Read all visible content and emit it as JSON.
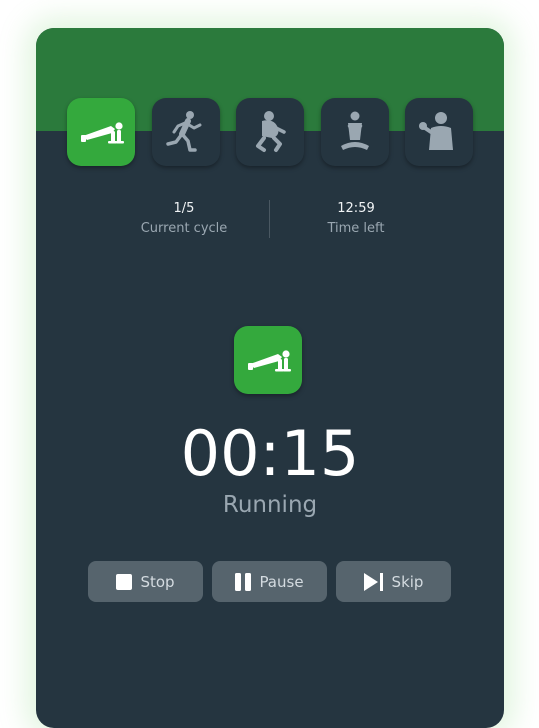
{
  "exercises": [
    {
      "name": "push-up",
      "active": true
    },
    {
      "name": "running",
      "active": false
    },
    {
      "name": "squat",
      "active": false
    },
    {
      "name": "meditation",
      "active": false
    },
    {
      "name": "dumbbell",
      "active": false
    }
  ],
  "stats": {
    "cycle_value": "1/5",
    "cycle_label": "Current cycle",
    "time_value": "12:59",
    "time_label": "Time left"
  },
  "current": {
    "icon": "push-up-icon",
    "timer": "00:15",
    "status": "Running"
  },
  "controls": {
    "stop_label": "Stop",
    "pause_label": "Pause",
    "skip_label": "Skip"
  },
  "colors": {
    "accent": "#34a93d",
    "header": "#2b7a3c",
    "card": "#253540",
    "button": "#56646d"
  }
}
